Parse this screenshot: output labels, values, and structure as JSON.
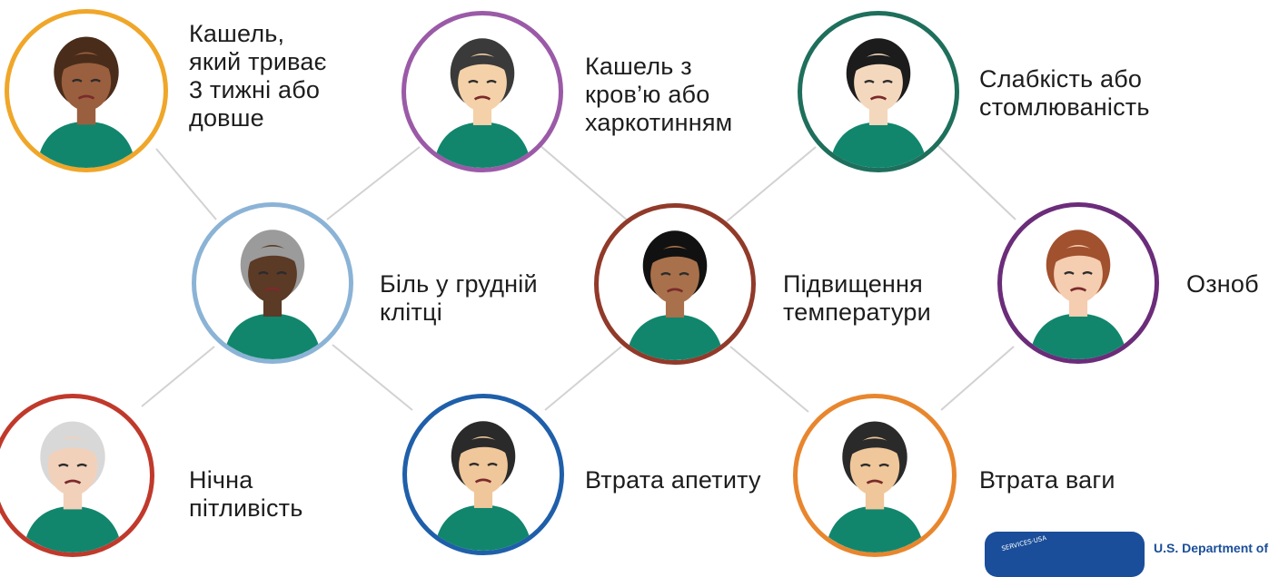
{
  "symptoms": [
    {
      "id": "cough",
      "label": "Кашель,\nякий триває\n3 тижні або\nдовше",
      "ring_color": "#f0a629",
      "skin": "#9a5f3e",
      "hair": "#4a2c1a"
    },
    {
      "id": "blood-cough",
      "label": "Кашель з\nкров’ю або\nхаркотинням",
      "ring_color": "#9b5aa7",
      "skin": "#f4d1a9",
      "hair": "#3a3a3a"
    },
    {
      "id": "weakness",
      "label": "Слабкість або\nстомлюваність",
      "ring_color": "#1e6f5c",
      "skin": "#f4d8bd",
      "hair": "#1c1c1c"
    },
    {
      "id": "chest-pain",
      "label": "Біль у грудній\nклітці",
      "ring_color": "#8bb3d6",
      "skin": "#5b3a26",
      "hair": "#9b9b9b"
    },
    {
      "id": "fever",
      "label": "Підвищення\nтемператури",
      "ring_color": "#913a2a",
      "skin": "#a8714b",
      "hair": "#111111"
    },
    {
      "id": "chills",
      "label": "Озноб",
      "ring_color": "#6b2c7a",
      "skin": "#f5cdb0",
      "hair": "#a1512e"
    },
    {
      "id": "night-sweats",
      "label": "Нічна\nпітливість",
      "ring_color": "#c0392b",
      "skin": "#f2d1bb",
      "hair": "#d8d8d8"
    },
    {
      "id": "appetite-loss",
      "label": "Втрата апетиту",
      "ring_color": "#1f5faa",
      "skin": "#f0c79a",
      "hair": "#2a2a2a"
    },
    {
      "id": "weight-loss",
      "label": "Втрата ваги",
      "ring_color": "#e8862e",
      "skin": "#f0c79a",
      "hair": "#2a2a2a"
    }
  ],
  "logo": {
    "seal_text": "SERVICES·USA",
    "department": "U.S. Department of"
  },
  "colors": {
    "shirt": "#11866d",
    "connector": "#d2d2d2"
  }
}
